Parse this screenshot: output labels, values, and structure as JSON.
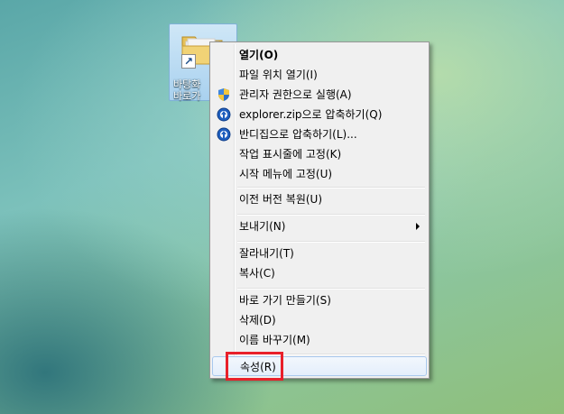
{
  "desktop_icon": {
    "label": "바탕화\n바로가",
    "shortcut_glyph": "↗"
  },
  "context_menu": {
    "items": [
      {
        "label": "열기(O)",
        "icon": "",
        "bold": true
      },
      {
        "label": "파일 위치 열기(I)",
        "icon": ""
      },
      {
        "label": "관리자 권한으로 실행(A)",
        "icon": "uac-shield-icon"
      },
      {
        "label": "explorer.zip으로 압축하기(Q)",
        "icon": "compress-icon"
      },
      {
        "label": "반디집으로 압축하기(L)...",
        "icon": "compress-icon"
      },
      {
        "label": "작업 표시줄에 고정(K)",
        "icon": ""
      },
      {
        "label": "시작 메뉴에 고정(U)",
        "icon": ""
      },
      {
        "label": "이전 버전 복원(U)",
        "icon": ""
      },
      {
        "label": "보내기(N)",
        "icon": "",
        "submenu": true
      },
      {
        "label": "잘라내기(T)",
        "icon": ""
      },
      {
        "label": "복사(C)",
        "icon": ""
      },
      {
        "label": "바로 가기 만들기(S)",
        "icon": ""
      },
      {
        "label": "삭제(D)",
        "icon": ""
      },
      {
        "label": "이름 바꾸기(M)",
        "icon": ""
      },
      {
        "label": "속성(R)",
        "icon": "",
        "hovered": true
      }
    ]
  },
  "colors": {
    "highlight_border": "#e8202a",
    "menu_background": "#f0f0f0",
    "hover_border": "#a8c8ee"
  }
}
